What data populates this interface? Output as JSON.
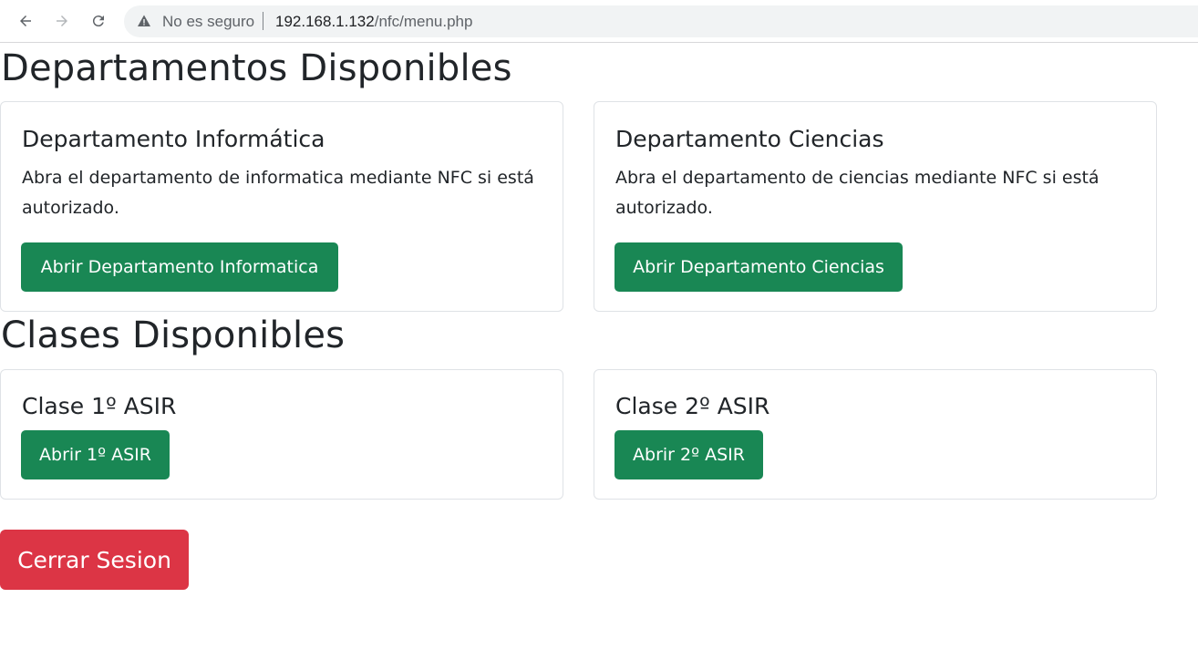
{
  "browser": {
    "security_label": "No es seguro",
    "url_host": "192.168.1.132",
    "url_path": "/nfc/menu.php"
  },
  "departamentos": {
    "heading": "Departamentos Disponibles",
    "cards": [
      {
        "title": "Departamento Informática",
        "text": "Abra el departamento de informatica mediante NFC si está autorizado.",
        "button": "Abrir Departamento Informatica"
      },
      {
        "title": "Departamento Ciencias",
        "text": "Abra el departamento de ciencias mediante NFC si está autorizado.",
        "button": "Abrir Departamento Ciencias"
      }
    ]
  },
  "clases": {
    "heading": "Clases Disponibles",
    "cards": [
      {
        "title": "Clase 1º ASIR",
        "button": "Abrir 1º ASIR"
      },
      {
        "title": "Clase 2º ASIR",
        "button": "Abrir 2º ASIR"
      }
    ]
  },
  "logout_label": "Cerrar Sesion",
  "colors": {
    "success": "#198754",
    "danger": "#dc3545",
    "text": "#212529"
  }
}
